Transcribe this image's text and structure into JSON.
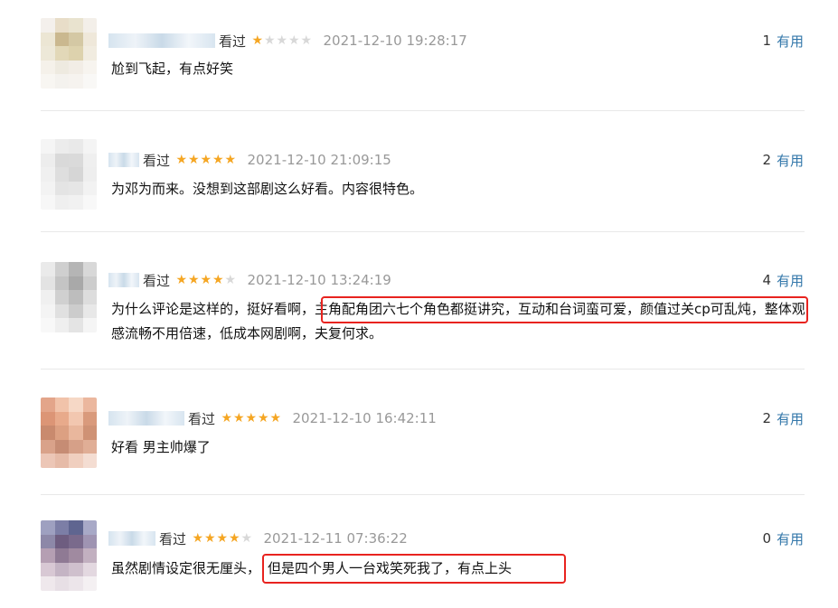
{
  "reviews": [
    {
      "status": "看过",
      "rating": 1,
      "time": "2021-12-10 19:28:17",
      "useful_count": "1",
      "useful_label": "有用",
      "content_before": "尬到飞起，有点好笑",
      "content_highlight": "",
      "content_after": "",
      "avatar_colors": [
        "#f4f0ec",
        "#e8ddc8",
        "#e9e3cf",
        "#f3efe9",
        "#ece6d4",
        "#cab88f",
        "#d4c8a4",
        "#efe8da",
        "#ede8d8",
        "#e2d8b8",
        "#ddd2ad",
        "#f1ece0",
        "#f5f1ea",
        "#eeeae0",
        "#f2ede6",
        "#f7f4ef",
        "#f8f6f2",
        "#f4f2ee",
        "#f6f3ef",
        "#f9f8f6"
      ]
    },
    {
      "status": "看过",
      "rating": 5,
      "time": "2021-12-10 21:09:15",
      "useful_count": "2",
      "useful_label": "有用",
      "content_before": "为邓为而来。没想到这部剧这么好看。内容很特色。",
      "content_highlight": "",
      "content_after": "",
      "avatar_colors": [
        "#f5f5f5",
        "#ececec",
        "#e9e9e9",
        "#f4f4f4",
        "#ededed",
        "#d9d9d9",
        "#dadada",
        "#efefef",
        "#f0f0f0",
        "#dedede",
        "#d6d6d6",
        "#eeeeee",
        "#f3f3f3",
        "#e4e4e4",
        "#e6e6e6",
        "#f2f2f2",
        "#f7f7f7",
        "#efefef",
        "#f1f1f1",
        "#f8f8f8"
      ]
    },
    {
      "status": "看过",
      "rating": 4,
      "time": "2021-12-10 13:24:19",
      "useful_count": "4",
      "useful_label": "有用",
      "content_before": "为什么评论是这样的，挺好看啊，",
      "content_highlight": "主角配角团六七个角色都挺讲究，互动和台词蛮可爱，颜值过关cp可乱",
      "content_after": "炖，整体观感流畅不用倍速，低成本网剧啊，夫复何求。",
      "avatar_colors": [
        "#eaeaea",
        "#cfcfcf",
        "#b5b5b5",
        "#d8d8d8",
        "#e3e3e3",
        "#c4c4c4",
        "#a9a9a9",
        "#cdcdcd",
        "#f0f0f0",
        "#d0d0d0",
        "#bdbdbd",
        "#dddddd",
        "#f4f4f4",
        "#e0e0e0",
        "#cccccc",
        "#e8e8e8",
        "#f8f8f8",
        "#efefef",
        "#e4e4e4",
        "#f5f5f5"
      ]
    },
    {
      "status": "看过",
      "rating": 5,
      "time": "2021-12-10 16:42:11",
      "useful_count": "2",
      "useful_label": "有用",
      "content_before": "好看 男主帅爆了",
      "content_highlight": "",
      "content_after": "",
      "avatar_colors": [
        "#e3a58a",
        "#f1c3aa",
        "#f6d8c6",
        "#ebb79e",
        "#dc9576",
        "#e8aa8b",
        "#f2c7b0",
        "#d99a7c",
        "#c98a6e",
        "#dca082",
        "#e9b79d",
        "#cf9275",
        "#d9a28a",
        "#c68c74",
        "#d6a088",
        "#e0ae96",
        "#ecc6b6",
        "#e6bba8",
        "#f0cfbf",
        "#f4ddd2"
      ]
    },
    {
      "status": "看过",
      "rating": 4,
      "time": "2021-12-11 07:36:22",
      "useful_count": "0",
      "useful_label": "有用",
      "content_before": "虽然剧情设定很无厘头，",
      "content_highlight": "但是四个男人一台戏笑死我了，有点上头",
      "content_after": "",
      "avatar_colors": [
        "#9ea0c0",
        "#7c7ea6",
        "#5f6590",
        "#a8a9c7",
        "#8d88a8",
        "#6e5d80",
        "#7a6a8c",
        "#9f94b2",
        "#b59fb3",
        "#8f7a94",
        "#a08aa0",
        "#c2b0c0",
        "#d8c8d4",
        "#c4b4c4",
        "#cfc0cd",
        "#e3d8e0",
        "#efe8ec",
        "#e7dfe5",
        "#ece5ea",
        "#f4f0f2"
      ]
    }
  ]
}
